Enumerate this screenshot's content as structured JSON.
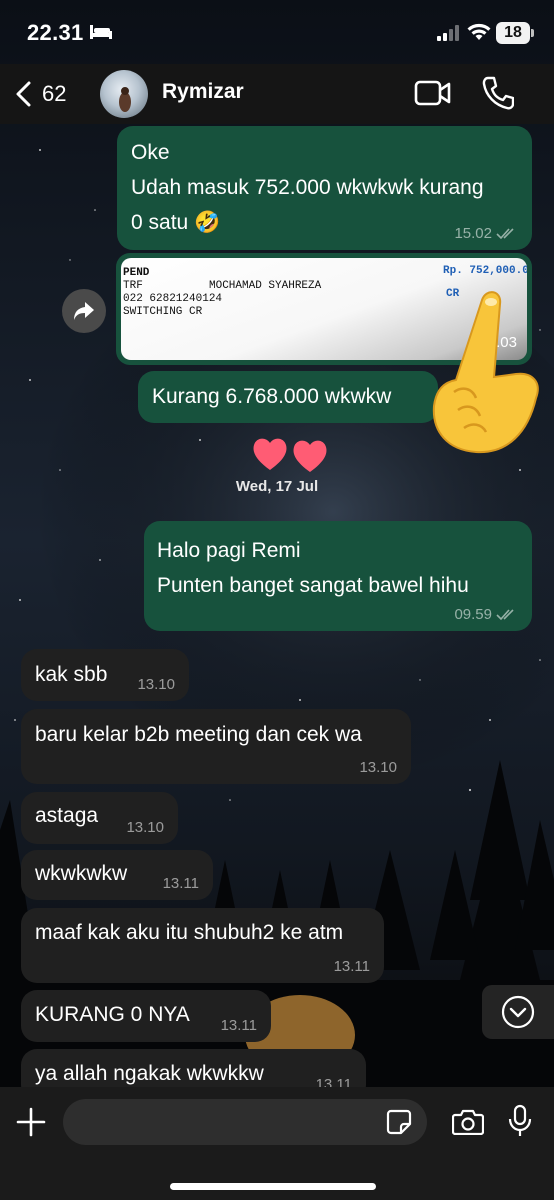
{
  "status_bar": {
    "time": "22.31",
    "battery": "18"
  },
  "header": {
    "back_count": "62",
    "contact_name": "Rymizar"
  },
  "messages": [
    {
      "lines": [
        "Oke",
        "Udah masuk 752.000 wkwkwk kurang",
        "0 satu 🤣"
      ],
      "time": "15.02"
    },
    {
      "receipt": {
        "line1": "PEND",
        "line2_a": "TRF",
        "line2_b": "MOCHAMAD SYAHREZA",
        "line3": "022  62821240124",
        "line4": "SWITCHING CR",
        "amount": "Rp.  752,000.0",
        "cr": "CR"
      },
      "time": "15.03"
    },
    {
      "lines": [
        "Kurang 6.768.000 wkwkw"
      ]
    },
    {
      "lines": [
        "Halo pagi Remi",
        "Punten banget sangat bawel hihu"
      ],
      "time": "09.59"
    },
    {
      "lines": [
        "kak sbb"
      ],
      "time": "13.10"
    },
    {
      "lines": [
        "baru kelar b2b meeting dan cek wa"
      ],
      "time": "13.10"
    },
    {
      "lines": [
        "astaga"
      ],
      "time": "13.10"
    },
    {
      "lines": [
        "wkwkwkw"
      ],
      "time": "13.11"
    },
    {
      "lines": [
        "maaf kak aku itu shubuh2 ke atm"
      ],
      "time": "13.11"
    },
    {
      "lines": [
        "KURANG 0 NYA"
      ],
      "time": "13.11"
    },
    {
      "lines": [
        "ya allah ngakak wkwkkw"
      ],
      "time": "13.11"
    }
  ],
  "date_separator": "Wed, 17 Jul",
  "input": {
    "placeholder": ""
  },
  "colors": {
    "outgoing_bubble": "#17523d",
    "incoming_bubble": "#202020",
    "header": "#161616"
  }
}
